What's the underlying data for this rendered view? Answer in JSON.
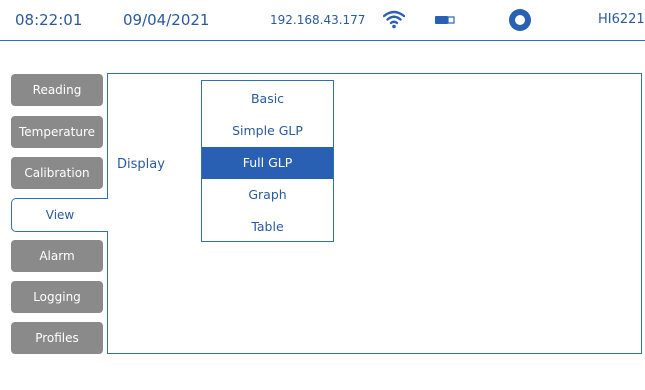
{
  "status": {
    "time": "08:22:01",
    "date": "09/04/2021",
    "ip": "192.168.43.177",
    "model": "HI6221",
    "wifi_icon": "wifi-icon",
    "battery_icon": "battery-icon",
    "record_icon": "record-icon",
    "accent_color": "#2a60b4"
  },
  "tabs": [
    {
      "label": "Reading"
    },
    {
      "label": "Temperature"
    },
    {
      "label": "Calibration"
    },
    {
      "label": "View",
      "active": true
    },
    {
      "label": "Alarm"
    },
    {
      "label": "Logging"
    },
    {
      "label": "Profiles"
    }
  ],
  "view": {
    "display_label": "Display",
    "options": [
      {
        "label": "Basic"
      },
      {
        "label": "Simple GLP"
      },
      {
        "label": "Full GLP",
        "selected": true
      },
      {
        "label": "Graph"
      },
      {
        "label": "Table"
      }
    ]
  }
}
